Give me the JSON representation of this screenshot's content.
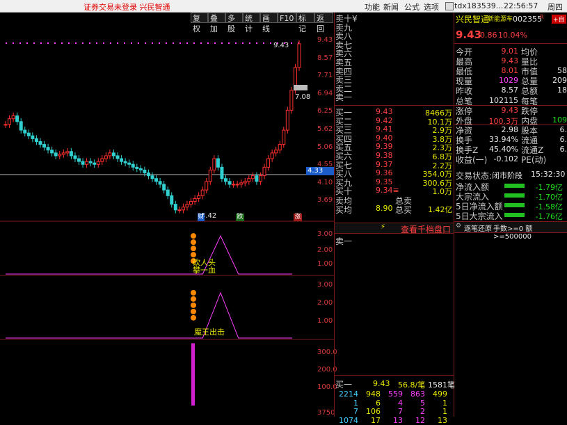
{
  "topbar": {
    "warning": "证券交易未登录  兴民智通",
    "menu": [
      "功能",
      "新闻",
      "公式",
      "选项"
    ],
    "user": "tdx183539...",
    "clock": "22:56:57",
    "weekday": "周四"
  },
  "toolbar": [
    "复权",
    "叠加",
    "多股",
    "统计",
    "画线",
    "F10",
    "标记",
    "返回"
  ],
  "main_chart": {
    "price_axis": [
      "9.43",
      "8.57",
      "7.71",
      "6.94",
      "6.25",
      "5.62",
      "5.06",
      "4.55",
      "4.10",
      "3.69"
    ],
    "high_label": "9.43",
    "right_tag": "7.08",
    "cur_price_tag": "4.33",
    "low_label": "3.42",
    "event_badges": [
      "财",
      "跌",
      "涨"
    ]
  },
  "chart_data": [
    {
      "type": "candlestick",
      "title": "",
      "ylabel": "",
      "ylim": [
        3.4,
        9.6
      ],
      "series": [
        {
          "name": "",
          "values": [
            6.6,
            6.8,
            6.9,
            6.7,
            6.4,
            6.3,
            6.2,
            6.1,
            6.0,
            5.9,
            5.8,
            5.7,
            5.6,
            5.5,
            5.55,
            5.6,
            5.65,
            5.5,
            5.4,
            5.3,
            5.2,
            5.3,
            5.25,
            5.2,
            5.3,
            5.4,
            5.5,
            5.6,
            5.5,
            5.4,
            5.3,
            5.25,
            5.2,
            5.1,
            5.05,
            5.0,
            4.9,
            4.8,
            4.7,
            4.6,
            4.5,
            4.3,
            4.1,
            3.8,
            3.6,
            3.6,
            3.7,
            3.8,
            3.9,
            4.0,
            4.1,
            4.3,
            4.6,
            5.0,
            5.4,
            5.1,
            4.7,
            4.6,
            4.5,
            4.5,
            4.5,
            4.55,
            4.6,
            4.7,
            4.8,
            4.6,
            4.8,
            5.1,
            5.4,
            5.6,
            5.7,
            5.9,
            6.4,
            7.1,
            7.8,
            8.6,
            9.43
          ]
        }
      ]
    },
    {
      "type": "line",
      "ylim": [
        0,
        3.5
      ],
      "series": [
        {
          "name": "",
          "values": [
            0,
            0,
            0,
            0,
            0,
            0,
            0,
            0,
            0,
            0,
            0,
            0,
            3.0,
            0,
            0,
            0,
            0
          ]
        }
      ]
    },
    {
      "type": "line",
      "ylim": [
        0,
        3.5
      ],
      "series": [
        {
          "name": "",
          "values": [
            0,
            0,
            0,
            0,
            0,
            0,
            0,
            0,
            0,
            0,
            0,
            0,
            3.0,
            0,
            0,
            0,
            0
          ]
        }
      ]
    },
    {
      "type": "bar",
      "ylim": [
        0,
        350
      ],
      "values": [
        0,
        0,
        0,
        0,
        0,
        0,
        0,
        0,
        0,
        0,
        0,
        0,
        0,
        330,
        0
      ]
    }
  ],
  "ind1": {
    "axis": [
      "3.00",
      "2.00",
      "1.00"
    ],
    "label1": "砍人头",
    "label2": "攀一血"
  },
  "ind2": {
    "axis": [
      "3.00",
      "2.00",
      "1.00"
    ],
    "label": "魔王出击"
  },
  "ind3": {
    "axis": [
      "300.0",
      "200.0",
      "100.0",
      "3750"
    ]
  },
  "orderbook": {
    "sell": [
      {
        "label": "卖十",
        "extra": "¥"
      },
      {
        "label": "卖九"
      },
      {
        "label": "卖八"
      },
      {
        "label": "卖七"
      },
      {
        "label": "卖六"
      },
      {
        "label": "卖五"
      },
      {
        "label": "卖四"
      },
      {
        "label": "卖三"
      },
      {
        "label": "卖二"
      },
      {
        "label": "卖一"
      }
    ],
    "buy": [
      {
        "label": "买一",
        "price": "9.43",
        "vol": "8466万"
      },
      {
        "label": "买二",
        "price": "9.42",
        "vol": "10.1万"
      },
      {
        "label": "买三",
        "price": "9.41",
        "vol": "2.9万"
      },
      {
        "label": "买四",
        "price": "9.40",
        "vol": "3.8万"
      },
      {
        "label": "买五",
        "price": "9.39",
        "vol": "2.3万"
      },
      {
        "label": "买六",
        "price": "9.38",
        "vol": "6.8万"
      },
      {
        "label": "买七",
        "price": "9.37",
        "vol": "2.2万"
      },
      {
        "label": "买八",
        "price": "9.36",
        "vol": "354.0万"
      },
      {
        "label": "买九",
        "price": "9.35",
        "vol": "300.6万"
      },
      {
        "label": "买十",
        "price": "9.34",
        "vol": "1.0万",
        "mark": "≡"
      }
    ],
    "avg_sell_label": "卖均",
    "total_sell_label": "总卖",
    "avg_buy_label": "买均",
    "avg_buy": "8.90",
    "total_buy_label": "总买",
    "total_buy": "1.42亿",
    "view_button": "查看千档盘口",
    "sell1_label": "卖一",
    "bottom": {
      "label": "买一",
      "price": "9.43",
      "lot": "56.8/笔",
      "count": "1581笔",
      "rows": [
        [
          "2214",
          "948",
          "559",
          "863",
          "499"
        ],
        [
          "1",
          "6",
          "4",
          "5",
          "1"
        ],
        [
          "7",
          "106",
          "7",
          "2",
          "1"
        ],
        [
          "1074",
          "17",
          "13",
          "12",
          "13"
        ]
      ]
    }
  },
  "quote": {
    "name": "兴民智通",
    "concept": "新能源车",
    "code": "002355",
    "tag": "R",
    "add": "+自",
    "price": "9.43",
    "change": "0.86",
    "pct": "10.04%",
    "rows": [
      {
        "l1": "今开",
        "v1": "9.01",
        "l2": "均价",
        "v2": ""
      },
      {
        "l1": "最高",
        "v1": "9.43",
        "l2": "量比",
        "v2": ""
      },
      {
        "l1": "最低",
        "v1": "8.01",
        "l2": "市值",
        "v2": "58"
      },
      {
        "l1": "现量",
        "v1": "1029",
        "l2": "总量",
        "v2": "209"
      },
      {
        "l1": "昨收",
        "v1": "8.57",
        "l2": "总额",
        "v2": "18"
      },
      {
        "l1": "总笔",
        "v1": "102115",
        "l2": "每笔",
        "v2": ""
      },
      {
        "l1": "涨停",
        "v1": "9.43",
        "l2": "跌停",
        "v2": ""
      },
      {
        "l1": "外盘",
        "v1": "100.3万",
        "l2": "内盘",
        "v2": "109"
      },
      {
        "l1": "净资",
        "v1": "2.98",
        "l2": "股本",
        "v2": "6."
      },
      {
        "l1": "换手",
        "v1": "33.94%",
        "l2": "流通",
        "v2": "6."
      },
      {
        "l1": "换手Z",
        "v1": "45.40%",
        "l2": "流通Z",
        "v2": "6."
      },
      {
        "l1": "收益(一)",
        "v1": "-0.102",
        "l2": "PE(动)",
        "v2": ""
      }
    ],
    "status_label": "交易状态:",
    "status": "闭市阶段",
    "status_time": "15:32:30",
    "flows": [
      {
        "label": "净流入额",
        "val": "-1.79亿",
        "fill": 0.12
      },
      {
        "label": "大宗流入",
        "val": "-1.70亿",
        "fill": 0.12
      },
      {
        "label": "5日净流入额",
        "val": "-1.58亿",
        "fill": 0.12
      },
      {
        "label": "5日大宗流入",
        "val": "-1.76亿",
        "fill": 0.12
      }
    ],
    "tick_title": "逐笔还原",
    "tick_filter": "手数>=0 额>=500000"
  }
}
